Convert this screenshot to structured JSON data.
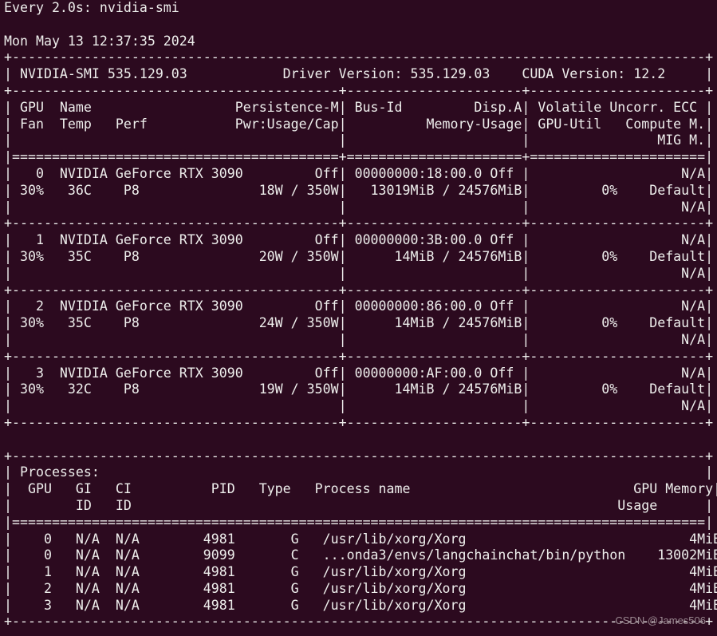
{
  "watch_header": "Every 2.0s: nvidia-smi",
  "timestamp": "Mon May 13 12:37:35 2024",
  "smi_version_label": "NVIDIA-SMI 535.129.03",
  "driver_version_label": "Driver Version: 535.129.03",
  "cuda_version_label": "CUDA Version: 12.2",
  "gpu_table_headers": [
    [
      "GPU",
      "Name",
      "Persistence-M",
      "Bus-Id",
      "Disp.A",
      "Volatile Uncorr. ECC"
    ],
    [
      "Fan",
      "Temp",
      "Perf",
      "Pwr:Usage/Cap",
      "Memory-Usage",
      "GPU-Util",
      "Compute M."
    ],
    [
      "MIG M."
    ]
  ],
  "gpus": [
    {
      "index": "0",
      "name": "NVIDIA GeForce RTX 3090",
      "persistence": "Off",
      "bus_id": "00000000:18:00.0",
      "disp": "Off",
      "ecc": "N/A",
      "fan": "30%",
      "temp": "36C",
      "perf": "P8",
      "power": "18W / 350W",
      "memory": "13019MiB / 24576MiB",
      "util": "0%",
      "compute": "Default",
      "mig": "N/A"
    },
    {
      "index": "1",
      "name": "NVIDIA GeForce RTX 3090",
      "persistence": "Off",
      "bus_id": "00000000:3B:00.0",
      "disp": "Off",
      "ecc": "N/A",
      "fan": "30%",
      "temp": "35C",
      "perf": "P8",
      "power": "20W / 350W",
      "memory": "14MiB / 24576MiB",
      "util": "0%",
      "compute": "Default",
      "mig": "N/A"
    },
    {
      "index": "2",
      "name": "NVIDIA GeForce RTX 3090",
      "persistence": "Off",
      "bus_id": "00000000:86:00.0",
      "disp": "Off",
      "ecc": "N/A",
      "fan": "30%",
      "temp": "35C",
      "perf": "P8",
      "power": "24W / 350W",
      "memory": "14MiB / 24576MiB",
      "util": "0%",
      "compute": "Default",
      "mig": "N/A"
    },
    {
      "index": "3",
      "name": "NVIDIA GeForce RTX 3090",
      "persistence": "Off",
      "bus_id": "00000000:AF:00.0",
      "disp": "Off",
      "ecc": "N/A",
      "fan": "30%",
      "temp": "32C",
      "perf": "P8",
      "power": "19W / 350W",
      "memory": "14MiB / 24576MiB",
      "util": "0%",
      "compute": "Default",
      "mig": "N/A"
    }
  ],
  "processes_title": "Processes:",
  "process_headers": [
    [
      "GPU",
      "GI",
      "CI",
      "PID",
      "Type",
      "Process name",
      "GPU Memory"
    ],
    [
      "ID",
      "ID",
      "Usage"
    ]
  ],
  "processes": [
    {
      "gpu": "0",
      "gi": "N/A",
      "ci": "N/A",
      "pid": "4981",
      "type": "G",
      "name": "/usr/lib/xorg/Xorg",
      "memory": "4MiB"
    },
    {
      "gpu": "0",
      "gi": "N/A",
      "ci": "N/A",
      "pid": "9099",
      "type": "C",
      "name": "...onda3/envs/langchainchat/bin/python",
      "memory": "13002MiB"
    },
    {
      "gpu": "1",
      "gi": "N/A",
      "ci": "N/A",
      "pid": "4981",
      "type": "G",
      "name": "/usr/lib/xorg/Xorg",
      "memory": "4MiB"
    },
    {
      "gpu": "2",
      "gi": "N/A",
      "ci": "N/A",
      "pid": "4981",
      "type": "G",
      "name": "/usr/lib/xorg/Xorg",
      "memory": "4MiB"
    },
    {
      "gpu": "3",
      "gi": "N/A",
      "ci": "N/A",
      "pid": "4981",
      "type": "G",
      "name": "/usr/lib/xorg/Xorg",
      "memory": "4MiB"
    }
  ],
  "watermark": "CSDN @James506",
  "colors": {
    "background": "#2c0a1f",
    "foreground": "#eeeeec"
  }
}
